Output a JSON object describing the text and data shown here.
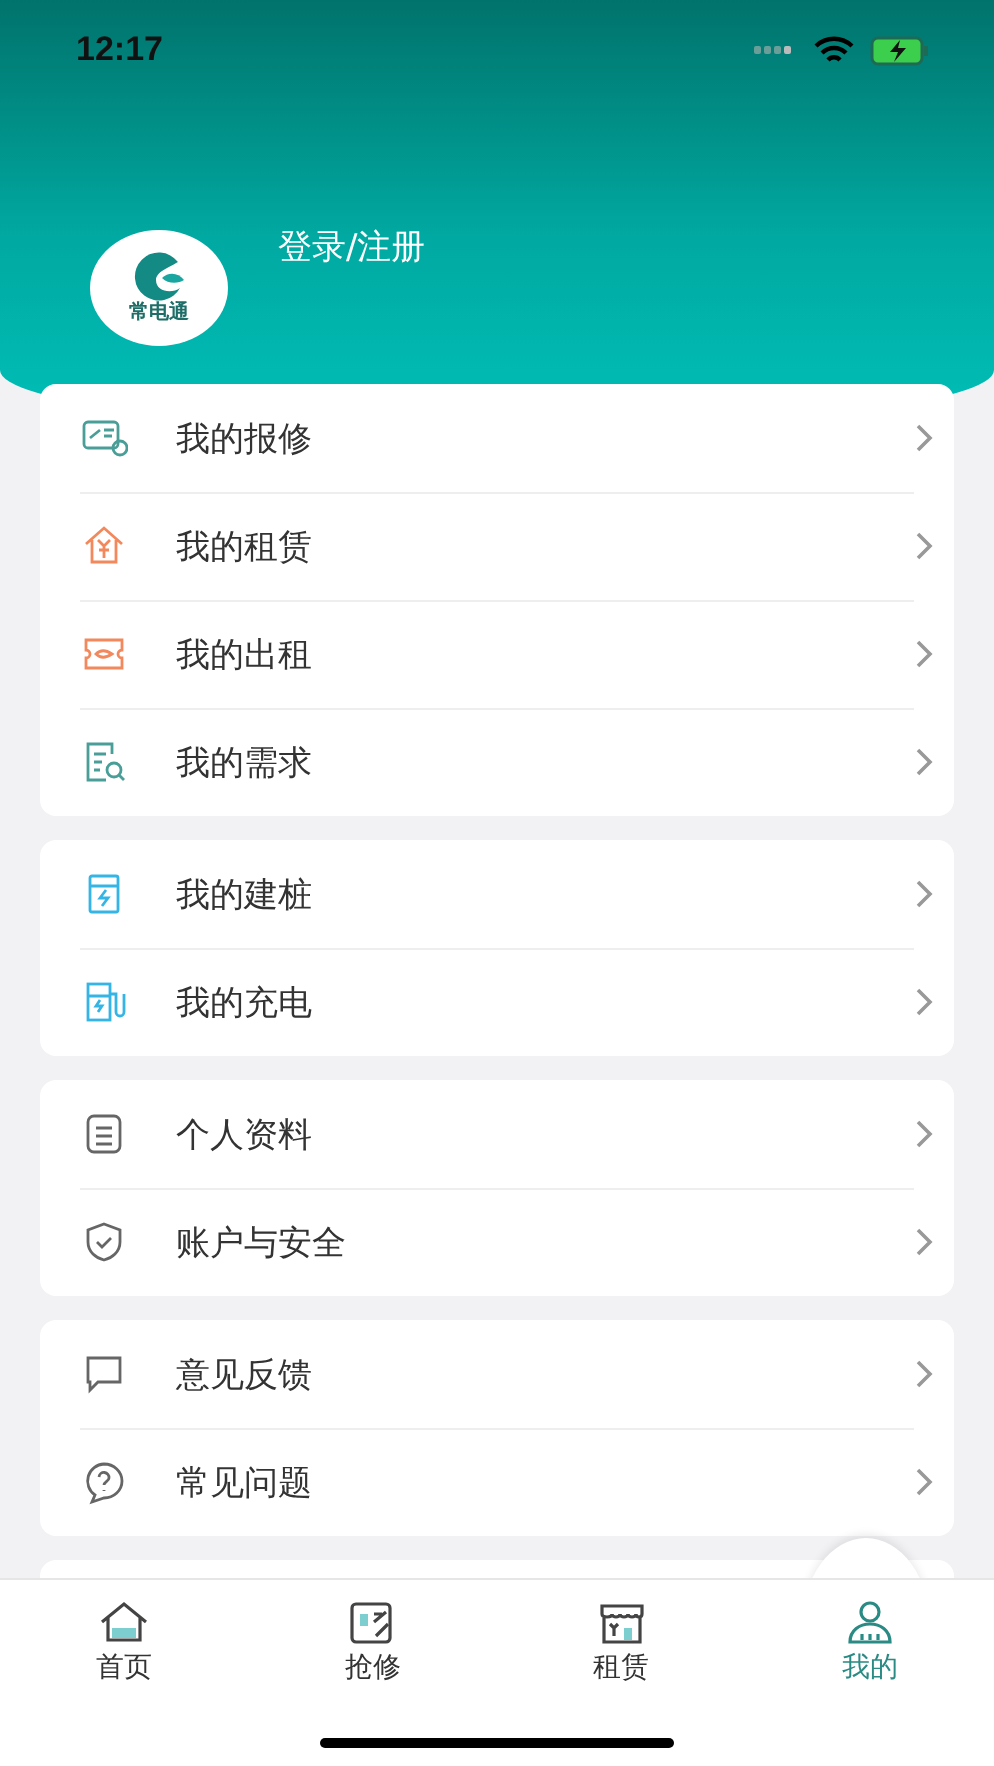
{
  "status_bar": {
    "time": "12:17"
  },
  "profile": {
    "logo_text": "常电通",
    "login": "登录/注册"
  },
  "menu_groups": [
    {
      "items": [
        {
          "kind": "repair",
          "label": "我的报修",
          "color": "#4a9e98"
        },
        {
          "kind": "rent",
          "label": "我的租赁",
          "color": "#f2885c"
        },
        {
          "kind": "lease",
          "label": "我的出租",
          "color": "#f2885c"
        },
        {
          "kind": "demand",
          "label": "我的需求",
          "color": "#4a9e98"
        }
      ]
    },
    {
      "items": [
        {
          "kind": "pile",
          "label": "我的建桩",
          "color": "#35b5e5"
        },
        {
          "kind": "charge",
          "label": "我的充电",
          "color": "#35b5e5"
        }
      ]
    },
    {
      "items": [
        {
          "kind": "profile",
          "label": "个人资料",
          "color": "#666666"
        },
        {
          "kind": "security",
          "label": "账户与安全",
          "color": "#666666"
        }
      ]
    },
    {
      "items": [
        {
          "kind": "feedback",
          "label": "意见反馈",
          "color": "#666666"
        },
        {
          "kind": "faq",
          "label": "常见问题",
          "color": "#666666"
        }
      ]
    }
  ],
  "tabs": [
    {
      "kind": "home",
      "label": "首页",
      "selected": false
    },
    {
      "kind": "repair",
      "label": "抢修",
      "selected": false
    },
    {
      "kind": "rent",
      "label": "租赁",
      "selected": false
    },
    {
      "kind": "mine",
      "label": "我的",
      "selected": true
    }
  ]
}
